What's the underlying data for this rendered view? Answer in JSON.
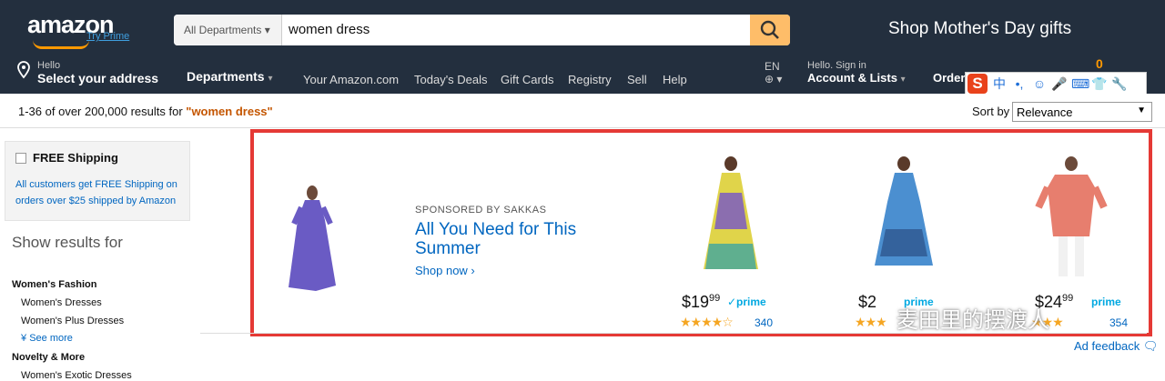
{
  "header": {
    "logo_text": "amazon",
    "try_prime": "Try Prime",
    "search": {
      "department": "All Departments",
      "query": "women dress"
    },
    "promo": "Shop Mother's Day gifts"
  },
  "nav": {
    "hello": "Hello",
    "address": "Select your address",
    "departments": "Departments",
    "links": [
      "Your Amazon.com",
      "Today's Deals",
      "Gift Cards",
      "Registry",
      "Sell",
      "Help"
    ],
    "language": "EN",
    "sign_in_hello": "Hello. Sign in",
    "account_lists": "Account & Lists",
    "orders": "Orders",
    "cart_count": "0"
  },
  "ime": {
    "logo": "S",
    "items": [
      "中",
      "•,",
      "☺",
      "🎤",
      "⌨",
      "👕",
      "🔧"
    ]
  },
  "results": {
    "prefix": "1-36 of over 200,000 results for ",
    "query": "\"women dress\"",
    "sort_label": "Sort by",
    "sort_value": "Relevance"
  },
  "sidebar": {
    "free_shipping": "FREE Shipping",
    "free_shipping_note": "All customers get FREE Shipping on orders over $25 shipped by Amazon",
    "show_results_for": "Show results for",
    "categories": [
      {
        "title": "Women's Fashion",
        "items": [
          "Women's Dresses",
          "Women's Plus Dresses"
        ],
        "see_more": "See more"
      },
      {
        "title": "Novelty & More",
        "items": [
          "Women's Exotic Dresses"
        ]
      }
    ]
  },
  "ad": {
    "sponsored": "SPONSORED BY SAKKAS",
    "title": "All You Need for This Summer",
    "shop_now": "Shop now ›",
    "products": [
      {
        "price_main": "$19",
        "price_cents": "99",
        "prime": "✓prime",
        "stars": "★★★★☆",
        "reviews": "340"
      },
      {
        "price_main": "$2",
        "price_cents": "",
        "prime": "prime",
        "stars": "★★★",
        "reviews": ""
      },
      {
        "price_main": "$24",
        "price_cents": "99",
        "prime": "prime",
        "stars": "★★★",
        "reviews": "354"
      }
    ],
    "feedback": "Ad feedback"
  },
  "watermark": "麦田里的摆渡人"
}
